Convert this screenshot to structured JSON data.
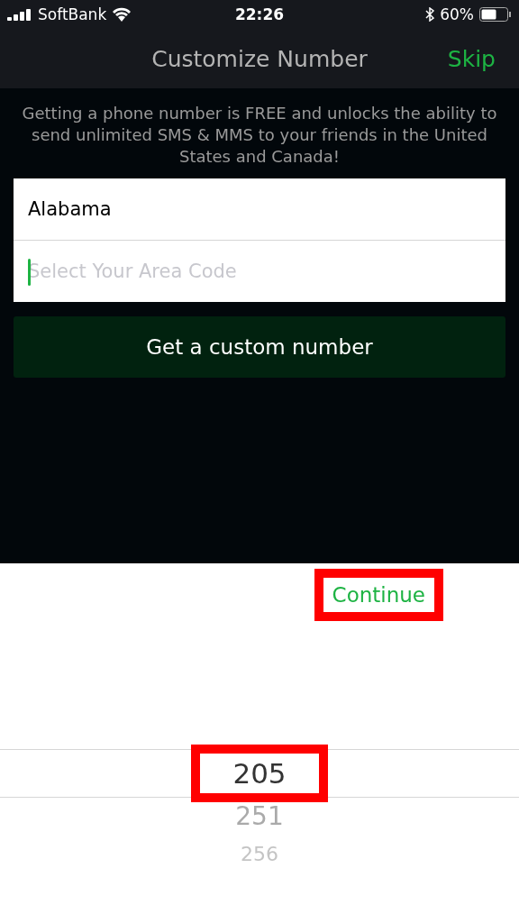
{
  "status_bar": {
    "carrier": "SoftBank",
    "time": "22:26",
    "battery": "60%"
  },
  "nav": {
    "title": "Customize Number",
    "action": "Skip"
  },
  "intro": "Getting a phone number is FREE and unlocks the ability to send unlimited SMS & MMS to your friends in the United States and Canada!",
  "form": {
    "state_value": "Alabama",
    "area_code_placeholder": "Select Your Area Code",
    "area_code_focused": true
  },
  "submit": "Get a custom number",
  "picker_toolbar": {
    "action": "Continue",
    "highlighted": true
  },
  "picker": [
    {
      "label": "205",
      "selected": true,
      "highlighted": true
    },
    {
      "label": "251",
      "selected": false,
      "highlighted": false
    },
    {
      "label": "256",
      "selected": false,
      "highlighted": false
    }
  ]
}
